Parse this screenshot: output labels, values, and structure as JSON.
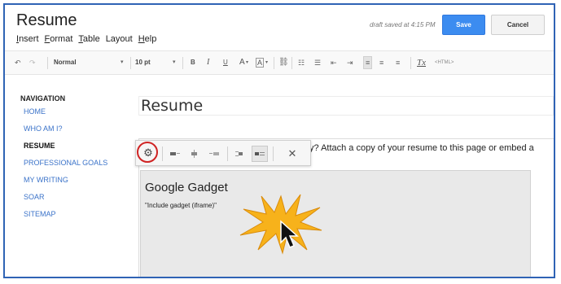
{
  "app": {
    "title": "Resume",
    "draft_status": "draft saved at 4:15 PM",
    "save_label": "Save",
    "cancel_label": "Cancel"
  },
  "menu": [
    "Insert",
    "Format",
    "Table",
    "Layout",
    "Help"
  ],
  "toolbar": {
    "style_select": "Normal",
    "size_select": "10 pt",
    "bold": "B",
    "italic": "I",
    "underline": "U",
    "text_color": "A",
    "highlight": "A",
    "clear_format": "Tx",
    "html": "<HTML>"
  },
  "navigation": {
    "heading": "NAVIGATION",
    "items": [
      {
        "label": "HOME",
        "current": false
      },
      {
        "label": "WHO AM I?",
        "current": false
      },
      {
        "label": "RESUME",
        "current": true
      },
      {
        "label": "PROFESSIONAL GOALS",
        "current": false
      },
      {
        "label": "MY WRITING",
        "current": false
      },
      {
        "label": "SOAR",
        "current": false
      },
      {
        "label": "SITEMAP",
        "current": false
      }
    ]
  },
  "page": {
    "title": "Resume",
    "body_text": "y? Attach a copy of your resume to this page or embed a"
  },
  "gadget": {
    "title": "Google Gadget",
    "subtitle": "\"Include gadget (iframe)\""
  },
  "colors": {
    "frame_border": "#2f63b5",
    "save_button": "#3c8cf0",
    "nav_link": "#3b73c9",
    "highlight_ring": "#cf2323",
    "starburst": "#f7b21b"
  }
}
